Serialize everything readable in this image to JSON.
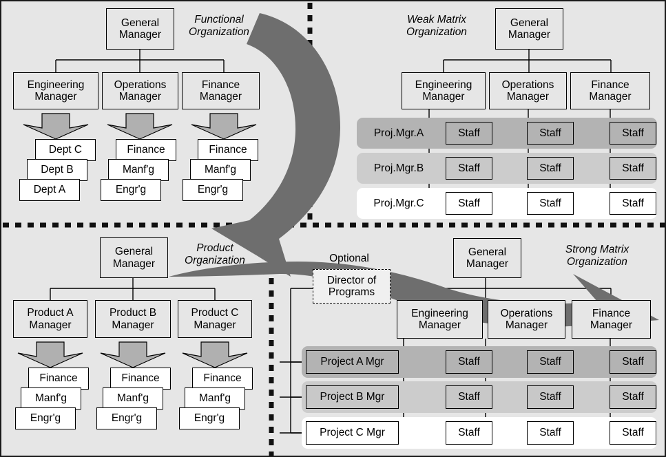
{
  "figure": {
    "title_functional": "Functional\nOrganization",
    "title_weak_matrix": "Weak Matrix\nOrganization",
    "title_product": "Product\nOrganization",
    "title_strong_matrix": "Strong Matrix\nOrganization",
    "colors": {
      "background": "#e6e6e6",
      "arrow": "#6e6e6e",
      "band_a": "#b3b3b3",
      "band_b": "#cccccc",
      "band_c": "#ffffff",
      "box_fill": "#e6e6e6",
      "box_white": "#ffffff",
      "outline": "#000000",
      "optional_fill": "#f0f0f0"
    }
  },
  "functional": {
    "top": "General\nManager",
    "managers": [
      "Engineering\nManager",
      "Operations\nManager",
      "Finance\nManager"
    ],
    "stacks": [
      [
        "Dept C",
        "Dept B",
        "Dept A"
      ],
      [
        "Finance",
        "Manf'g",
        "Engr'g"
      ],
      [
        "Finance",
        "Manf'g",
        "Engr'g"
      ]
    ]
  },
  "weak_matrix": {
    "top": "General\nManager",
    "managers": [
      "Engineering\nManager",
      "Operations\nManager",
      "Finance\nManager"
    ],
    "rows": [
      {
        "label": "Proj.Mgr.A",
        "staff": [
          "Staff",
          "Staff",
          "Staff"
        ],
        "shade": "a"
      },
      {
        "label": "Proj.Mgr.B",
        "staff": [
          "Staff",
          "Staff",
          "Staff"
        ],
        "shade": "b"
      },
      {
        "label": "Proj.Mgr.C",
        "staff": [
          "Staff",
          "Staff",
          "Staff"
        ],
        "shade": "c"
      }
    ]
  },
  "product": {
    "top": "General\nManager",
    "managers": [
      "Product A\nManager",
      "Product B\nManager",
      "Product C\nManager"
    ],
    "stacks": [
      [
        "Finance",
        "Manf'g",
        "Engr'g"
      ],
      [
        "Finance",
        "Manf'g",
        "Engr'g"
      ],
      [
        "Finance",
        "Manf'g",
        "Engr'g"
      ]
    ]
  },
  "strong_matrix": {
    "top": "General\nManager",
    "optional_caption": "Optional",
    "optional_box": "Director of\nPrograms",
    "managers": [
      "Engineering\nManager",
      "Operations\nManager",
      "Finance\nManager"
    ],
    "rows": [
      {
        "label": "Project A Mgr",
        "staff": [
          "Staff",
          "Staff",
          "Staff"
        ],
        "shade": "a"
      },
      {
        "label": "Project B Mgr",
        "staff": [
          "Staff",
          "Staff",
          "Staff"
        ],
        "shade": "b"
      },
      {
        "label": "Project C Mgr",
        "staff": [
          "Staff",
          "Staff",
          "Staff"
        ],
        "shade": "c"
      }
    ]
  }
}
